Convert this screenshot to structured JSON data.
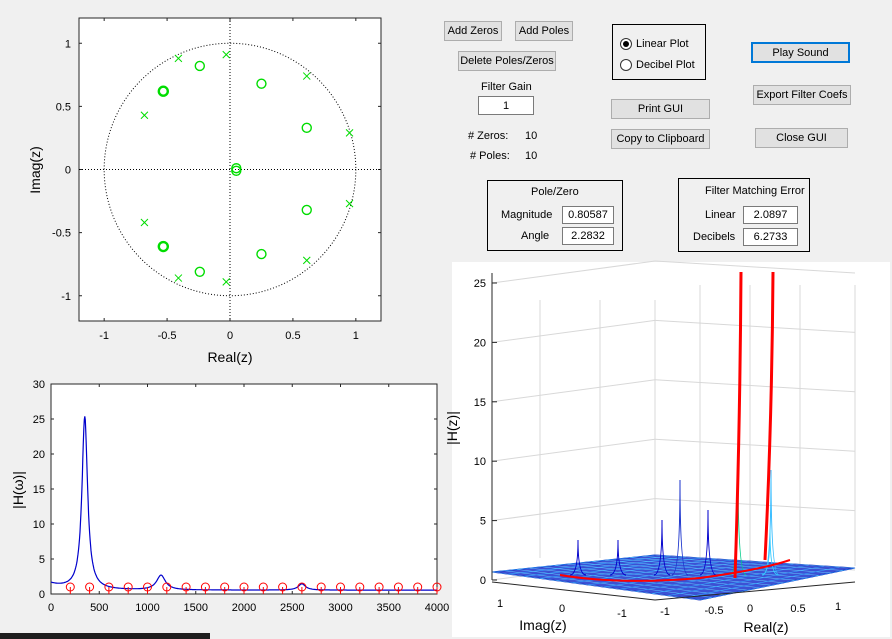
{
  "buttons": {
    "add_zeros": "Add Zeros",
    "add_poles": "Add Poles",
    "delete_poles_zeros": "Delete Poles/Zeros",
    "print_gui": "Print GUI",
    "copy_clipboard": "Copy to Clipboard",
    "play_sound": "Play Sound",
    "export_coefs": "Export Filter Coefs",
    "close_gui": "Close GUI"
  },
  "plot_mode": {
    "linear_label": "Linear Plot",
    "decibel_label": "Decibel Plot",
    "selected": "Linear Plot"
  },
  "filter_gain": {
    "label": "Filter Gain",
    "value": "1"
  },
  "counts": {
    "zeros_label": "# Zeros:",
    "zeros_value": "10",
    "poles_label": "# Poles:",
    "poles_value": "10"
  },
  "pole_zero_panel": {
    "title": "Pole/Zero",
    "magnitude_label": "Magnitude",
    "magnitude_value": "0.80587",
    "angle_label": "Angle",
    "angle_value": "2.2832"
  },
  "error_panel": {
    "title": "Filter Matching Error",
    "linear_label": "Linear",
    "linear_value": "2.0897",
    "decibels_label": "Decibels",
    "decibels_value": "6.2733"
  },
  "colors": {
    "markers": "#00dd00",
    "response": "#0000cc",
    "stems": "#ff0000"
  },
  "chart_data": [
    {
      "type": "scatter",
      "xlabel": "Real(z)",
      "ylabel": "Imag(z)",
      "xlim": [
        -1.2,
        1.2
      ],
      "ylim": [
        -1.2,
        1.2
      ],
      "xticks": [
        "-1",
        "-0.5",
        "0",
        "0.5",
        "1"
      ],
      "yticks": [
        "1",
        "0.5",
        "0",
        "-0.5",
        "-1"
      ],
      "unit_circle": true,
      "series": [
        {
          "marker": "x",
          "points": [
            [
              -0.03,
              0.91
            ],
            [
              -0.41,
              0.88
            ],
            [
              0.61,
              0.74
            ],
            [
              -0.68,
              0.43
            ],
            [
              0.95,
              0.29
            ],
            [
              0.95,
              -0.27
            ],
            [
              -0.68,
              -0.42
            ],
            [
              0.61,
              -0.72
            ],
            [
              -0.41,
              -0.86
            ],
            [
              -0.03,
              -0.89
            ]
          ]
        },
        {
          "marker": "o",
          "points": [
            [
              -0.24,
              0.82
            ],
            [
              0.25,
              0.68
            ],
            [
              -0.53,
              0.62
            ],
            [
              0.61,
              0.33
            ],
            [
              0.05,
              0.01
            ],
            [
              0.05,
              -0.01
            ],
            [
              0.61,
              -0.32
            ],
            [
              -0.53,
              -0.61
            ],
            [
              0.25,
              -0.67
            ],
            [
              -0.24,
              -0.81
            ]
          ]
        }
      ]
    },
    {
      "type": "line",
      "xlabel": "",
      "ylabel": "|H(ω)|",
      "xlim": [
        0,
        4000
      ],
      "ylim": [
        0,
        30
      ],
      "xticks": [
        "0",
        "500",
        "1000",
        "1500",
        "2000",
        "2500",
        "3000",
        "3500",
        "4000"
      ],
      "yticks": [
        "30",
        "25",
        "20",
        "15",
        "10",
        "5",
        "0"
      ],
      "peaks": [
        [
          350,
          25.7
        ],
        [
          1140,
          3.1
        ],
        [
          2600,
          1.9
        ]
      ],
      "baseline": 1.0,
      "stems_x": [
        200,
        400,
        600,
        800,
        1000,
        1200,
        1400,
        1600,
        1800,
        2000,
        2200,
        2400,
        2600,
        2800,
        3000,
        3200,
        3400,
        3600,
        3800,
        4000
      ],
      "stems_y": 1.0
    },
    {
      "type": "area",
      "xlabel": "Real(z)",
      "ylabel": "|H(z)|",
      "zlabel": "Imag(z)",
      "zticks": [
        "25",
        "20",
        "15",
        "10",
        "5",
        "0"
      ],
      "real_ticks": [
        "-1",
        "-0.5",
        "0",
        "0.5",
        "1"
      ],
      "imag_ticks": [
        "1",
        "0",
        "-1"
      ]
    }
  ]
}
